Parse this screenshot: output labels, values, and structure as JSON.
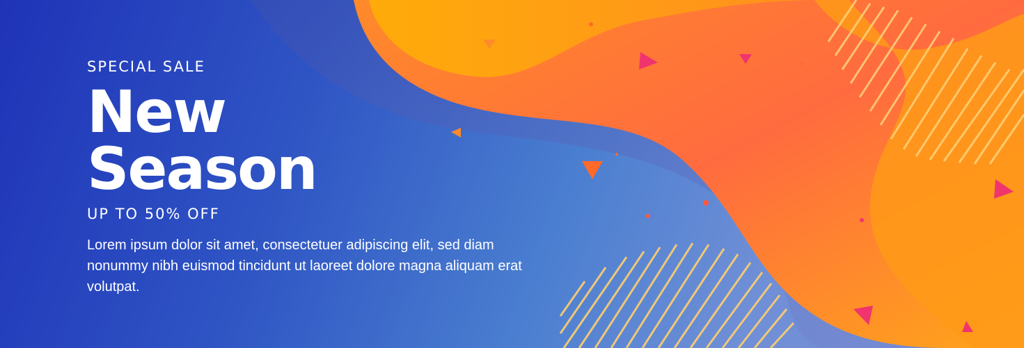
{
  "banner": {
    "eyebrow": "SPECIAL SALE",
    "headline_line1": "New",
    "headline_line2": "Season",
    "offer": "UP TO 50% OFF",
    "body": "Lorem ipsum dolor sit amet, consectetuer adipiscing elit, sed diam nonummy nibh euismod tincidunt ut laoreet dolore magna aliquam erat volutpat."
  },
  "colors": {
    "blue_dark": "#1f33b8",
    "blue_light": "#7a8ed4",
    "orange": "#ff9f1a",
    "orange_red": "#ff6a3d",
    "yellow": "#ffb300",
    "pink": "#f0346e",
    "text": "#ffffff"
  }
}
